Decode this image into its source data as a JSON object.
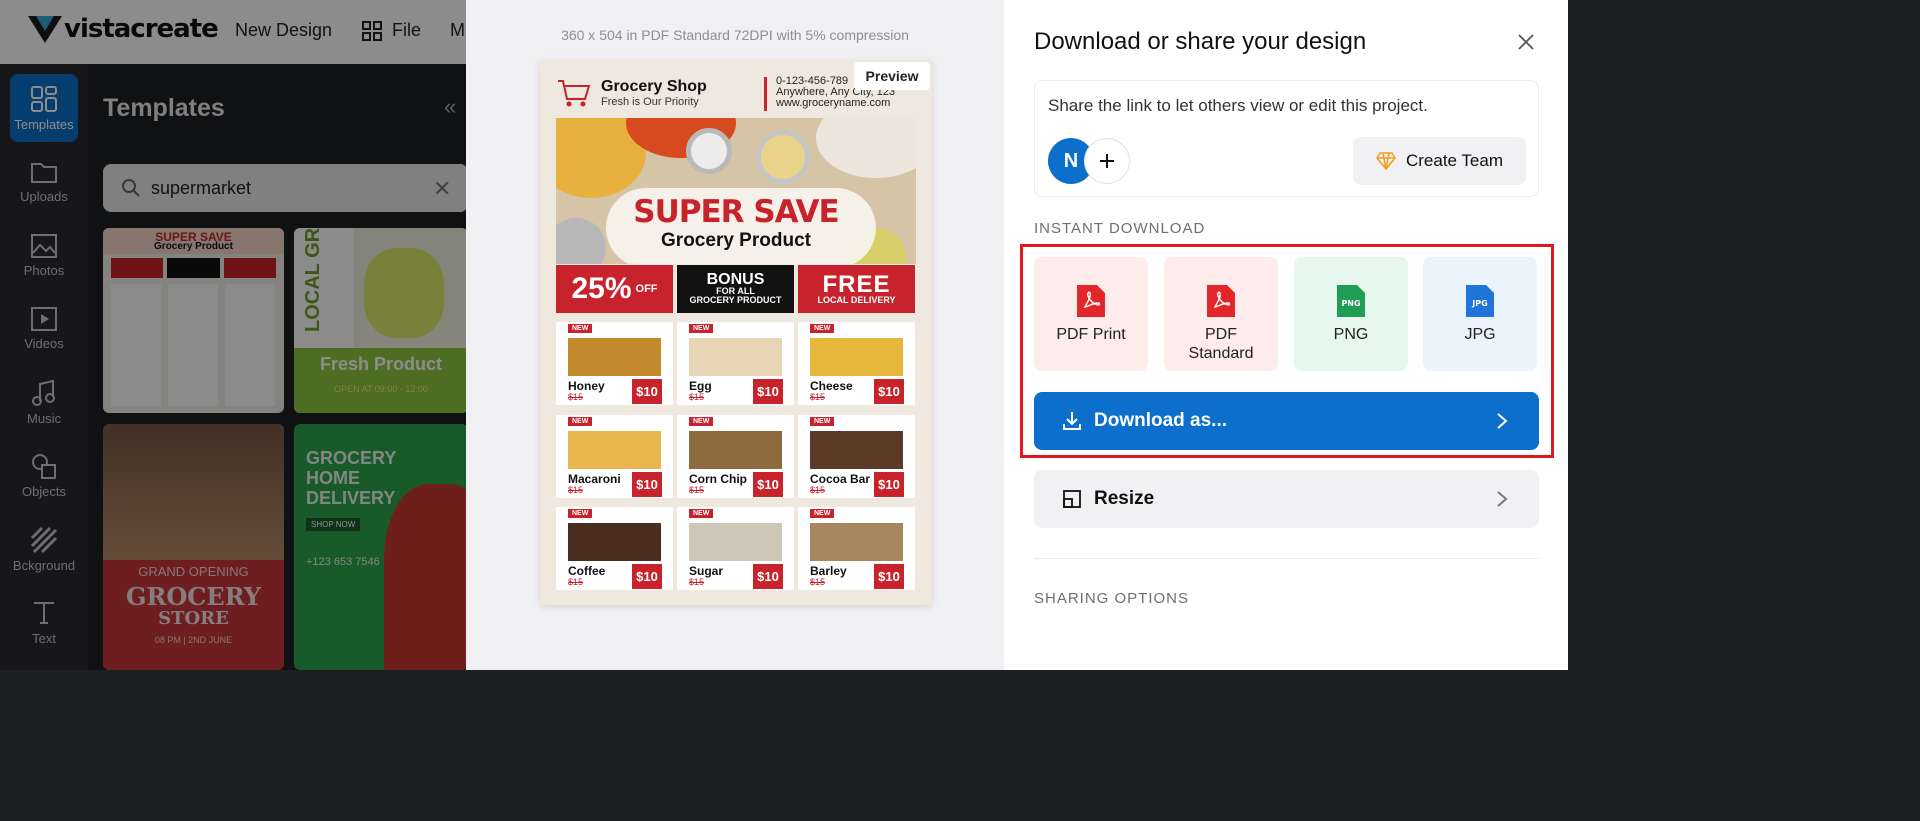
{
  "app": {
    "logo_text": "vistacreate",
    "menu": {
      "new_design": "New Design",
      "file": "File",
      "more_partial": "M"
    }
  },
  "sidebar": {
    "items": [
      {
        "label": "Templates",
        "icon": "templates-icon",
        "active": true
      },
      {
        "label": "Uploads",
        "icon": "folder-icon"
      },
      {
        "label": "Photos",
        "icon": "photo-icon"
      },
      {
        "label": "Videos",
        "icon": "video-icon"
      },
      {
        "label": "Music",
        "icon": "music-icon"
      },
      {
        "label": "Objects",
        "icon": "objects-icon"
      },
      {
        "label": "Bckground",
        "icon": "background-icon"
      },
      {
        "label": "Text",
        "icon": "text-icon"
      }
    ]
  },
  "templates_panel": {
    "title": "Templates",
    "search": {
      "value": "supermarket",
      "placeholder": ""
    },
    "thumbs": [
      {
        "title": "SUPER SAVE",
        "subtitle": "Grocery Product"
      },
      {
        "title": "LOCAL GRO",
        "footer": "Fresh Product",
        "open": "OPEN AT 09:00 - 12:00"
      },
      {
        "title": "GRAND OPENING",
        "main": "GROCERY",
        "main2": "STORE",
        "date": "08 PM | 2ND JUNE"
      },
      {
        "title": "GROCERY",
        "title2": "HOME",
        "title3": "DELIVERY",
        "cta": "SHOP NOW",
        "phone": "+123 653 7546"
      }
    ]
  },
  "preview": {
    "specs": "360 x 504 in PDF Standard 72DPI with 5% compression",
    "badge": "Preview",
    "flyer": {
      "shop_name": "Grocery Shop",
      "tagline": "Fresh is Our Priority",
      "phone": "0-123-456-789",
      "address": "Anywhere, Any City, 123",
      "website": "www.groceryname.com",
      "headline": "SUPER SAVE",
      "subheadline": "Grocery Product",
      "offer_pct": "25%",
      "offer_off": "OFF",
      "bonus": "BONUS",
      "bonus_sub1": "FOR ALL",
      "bonus_sub2": "GROCERY PRODUCT",
      "free": "FREE",
      "free_sub": "LOCAL DELIVERY",
      "new_tag": "NEW",
      "products": [
        {
          "name": "Honey",
          "old": "$15",
          "price": "$10",
          "color": "#c48a2e"
        },
        {
          "name": "Egg",
          "old": "$15",
          "price": "$10",
          "color": "#e8d5b5"
        },
        {
          "name": "Cheese",
          "old": "$15",
          "price": "$10",
          "color": "#e6b73a"
        },
        {
          "name": "Macaroni",
          "old": "$15",
          "price": "$10",
          "color": "#e7b74d"
        },
        {
          "name": "Corn Chip",
          "old": "$15",
          "price": "$10",
          "color": "#8c6a3e"
        },
        {
          "name": "Cocoa Bar",
          "old": "$15",
          "price": "$10",
          "color": "#5b3a28"
        },
        {
          "name": "Coffee",
          "old": "$15",
          "price": "$10",
          "color": "#4a2f20"
        },
        {
          "name": "Sugar",
          "old": "$15",
          "price": "$10",
          "color": "#cfc6b8"
        },
        {
          "name": "Barley",
          "old": "$15",
          "price": "$10",
          "color": "#a6875e"
        }
      ]
    }
  },
  "download_panel": {
    "title": "Download or share your design",
    "share_text": "Share the link to let others view or edit this project.",
    "avatar_initial": "N",
    "create_team": "Create Team",
    "instant_download_label": "INSTANT DOWNLOAD",
    "formats": [
      {
        "label": "PDF Print",
        "icon": "pdf-icon",
        "bg": "#fdecea"
      },
      {
        "label": "PDF Standard",
        "icon": "pdf-icon",
        "bg": "#fdecea"
      },
      {
        "label": "PNG",
        "icon": "png-icon",
        "bg": "#e5f7ee"
      },
      {
        "label": "JPG",
        "icon": "jpg-icon",
        "bg": "#ebf3fc"
      }
    ],
    "download_as": "Download as...",
    "resize": "Resize",
    "sharing_options_label": "SHARING OPTIONS",
    "colors": {
      "primary": "#0b6fcb",
      "highlight": "#e0181f",
      "pdf_red": "#e3262b",
      "png_green": "#1f9d55",
      "jpg_blue": "#1f74d8"
    }
  }
}
